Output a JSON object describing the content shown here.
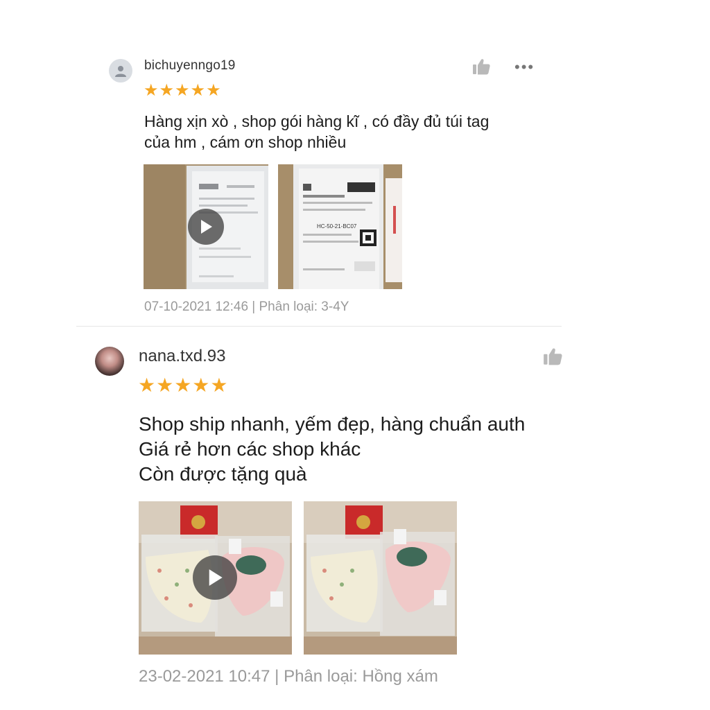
{
  "reviews": [
    {
      "username": "bichuyenngo19",
      "stars": "★★★★★",
      "rating": 5,
      "comment_lines": [
        "Hàng xịn xò , shop gói hàng kĩ , có đầy đủ túi tag",
        "của hm , cám ơn shop nhiều"
      ],
      "more_label": "•••",
      "meta": "07-10-2021 12:46 | Phân loại: 3-4Y",
      "media": [
        {
          "type": "video",
          "icon": "play-icon"
        },
        {
          "type": "image",
          "label": "HC-50-21-BC07"
        }
      ]
    },
    {
      "username": "nana.txd.93",
      "stars": "★★★★★",
      "rating": 5,
      "comment_lines": [
        "Shop ship nhanh, yếm đẹp, hàng chuẩn auth",
        "Giá rẻ hơn các shop khác",
        "Còn được tặng quà"
      ],
      "meta": "23-02-2021 10:47 | Phân loại: Hồng xám",
      "media": [
        {
          "type": "video",
          "icon": "play-icon"
        },
        {
          "type": "image"
        }
      ]
    }
  ],
  "colors": {
    "star": "#f5a623",
    "meta_text": "#9a9a9a",
    "divider": "#e6e6e6"
  }
}
